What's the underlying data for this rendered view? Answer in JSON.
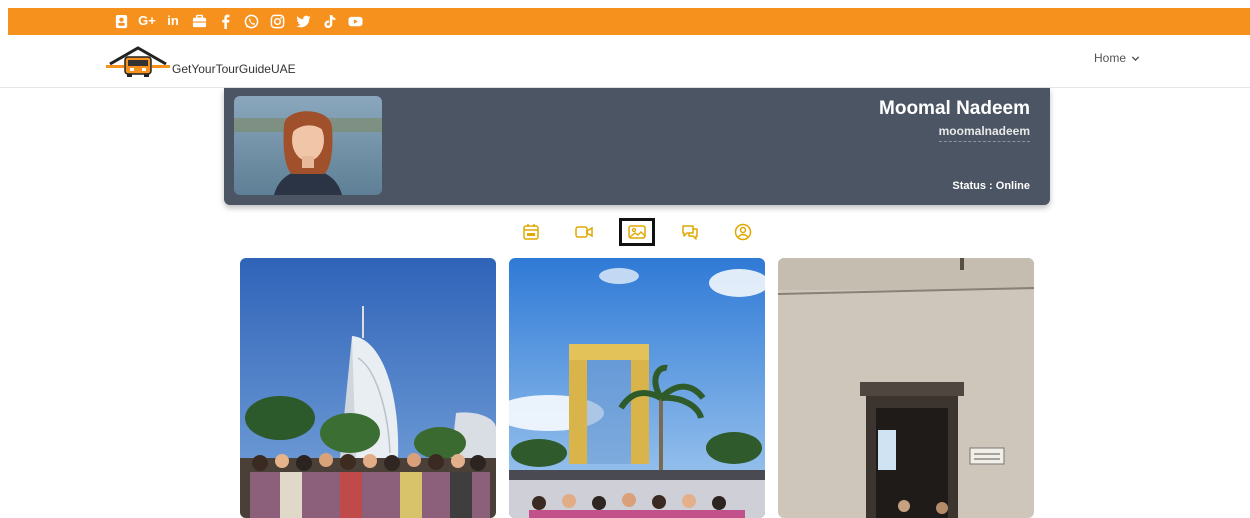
{
  "social": {
    "google_plus_label": "G+",
    "linkedin_label": "in",
    "icons": [
      "contacts-icon",
      "google-plus-icon",
      "linkedin-icon",
      "briefcase-icon",
      "facebook-icon",
      "whatsapp-icon",
      "instagram-icon",
      "twitter-icon",
      "tiktok-icon",
      "youtube-icon"
    ]
  },
  "nav": {
    "logo_text": "GetYourTourGuideUAE",
    "home_label": "Home"
  },
  "profile": {
    "name": "Moomal Nadeem",
    "username": "moomalnadeem",
    "status": "Status : Online"
  },
  "tabs": [
    {
      "icon": "calendar-icon"
    },
    {
      "icon": "video-icon"
    },
    {
      "icon": "image-icon",
      "active": true
    },
    {
      "icon": "chat-icon"
    },
    {
      "icon": "user-icon"
    }
  ],
  "colors": {
    "accent": "#f7911e",
    "profile_bg": "#4b5563",
    "tab_icon": "#e0a800"
  }
}
